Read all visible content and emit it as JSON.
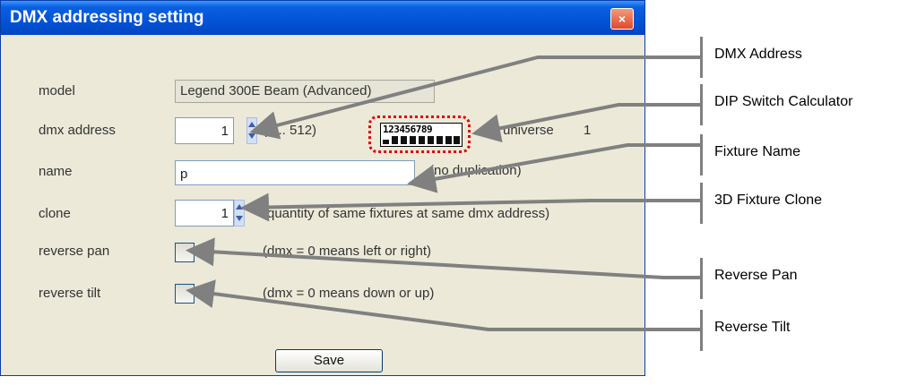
{
  "dialog": {
    "title": "DMX addressing setting",
    "close_symbol": "×",
    "fields": {
      "model": {
        "label": "model",
        "value": "Legend 300E Beam (Advanced)"
      },
      "dmx_address": {
        "label": "dmx address",
        "value": "1",
        "range_hint": "(1 .. 512)",
        "dip_digits": "123456789",
        "universe_label": "universe",
        "universe_value": "1"
      },
      "name": {
        "label": "name",
        "value": "p",
        "hint": "(no duplication)"
      },
      "clone": {
        "label": "clone",
        "value": "1",
        "hint": "(quantity of same fixtures at same dmx address)"
      },
      "reverse_pan": {
        "label": "reverse pan",
        "checked": false,
        "hint": "(dmx = 0 means left or right)"
      },
      "reverse_tilt": {
        "label": "reverse tilt",
        "checked": false,
        "hint": "(dmx = 0 means down or up)"
      }
    },
    "save_label": "Save"
  },
  "callouts": [
    {
      "label": "DMX Address"
    },
    {
      "label": "DIP Switch Calculator"
    },
    {
      "label": "Fixture Name"
    },
    {
      "label": "3D Fixture Clone"
    },
    {
      "label": "Reverse Pan"
    },
    {
      "label": "Reverse Tilt"
    }
  ],
  "colors": {
    "titlebar": "#0353d6",
    "dialog_bg": "#ece9d8",
    "callout_arrow": "#808080",
    "dip_highlight": "#e00000"
  }
}
